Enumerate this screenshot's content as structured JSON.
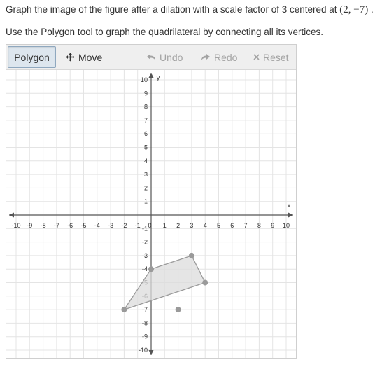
{
  "prompt": {
    "text": "Graph the image of the figure after a dilation with a scale factor of 3 centered at",
    "center": "(2, −7)",
    "tail": "."
  },
  "instruction": "Use the Polygon tool to graph the quadrilateral by connecting all its vertices.",
  "toolbar": {
    "polygon_label": "Polygon",
    "move_label": "Move",
    "undo_label": "Undo",
    "redo_label": "Redo",
    "reset_label": "Reset",
    "move_icon": "move-arrows-icon",
    "undo_icon": "undo-arrow-icon",
    "redo_icon": "redo-arrow-icon",
    "reset_icon": "close-x-icon"
  },
  "graph": {
    "x_axis_label": "x",
    "y_axis_label": "y",
    "x_range": [
      -10,
      10
    ],
    "y_range": [
      -10,
      10
    ],
    "x_ticks": [
      "-10",
      "-9",
      "-8",
      "-7",
      "-6",
      "-5",
      "-4",
      "-3",
      "-2",
      "-1",
      "0",
      "1",
      "2",
      "3",
      "4",
      "5",
      "6",
      "7",
      "8",
      "9",
      "10"
    ],
    "y_ticks": [
      "10",
      "9",
      "8",
      "7",
      "6",
      "5",
      "4",
      "3",
      "2",
      "1",
      "-1",
      "-2",
      "-3",
      "-4",
      "-5",
      "-6",
      "-7",
      "-8",
      "-9",
      "-10"
    ],
    "grid": true,
    "colors": {
      "grid": "#e4e4e4",
      "axis": "#555555",
      "polygon_fill": "#dcdcdc",
      "polygon_stroke": "#9a9a9a",
      "point": "#9a9a9a"
    },
    "polygon_vertices": [
      [
        0,
        -4
      ],
      [
        3,
        -3
      ],
      [
        4,
        -5
      ],
      [
        -2,
        -7
      ]
    ],
    "center_point": [
      2,
      -7
    ]
  }
}
